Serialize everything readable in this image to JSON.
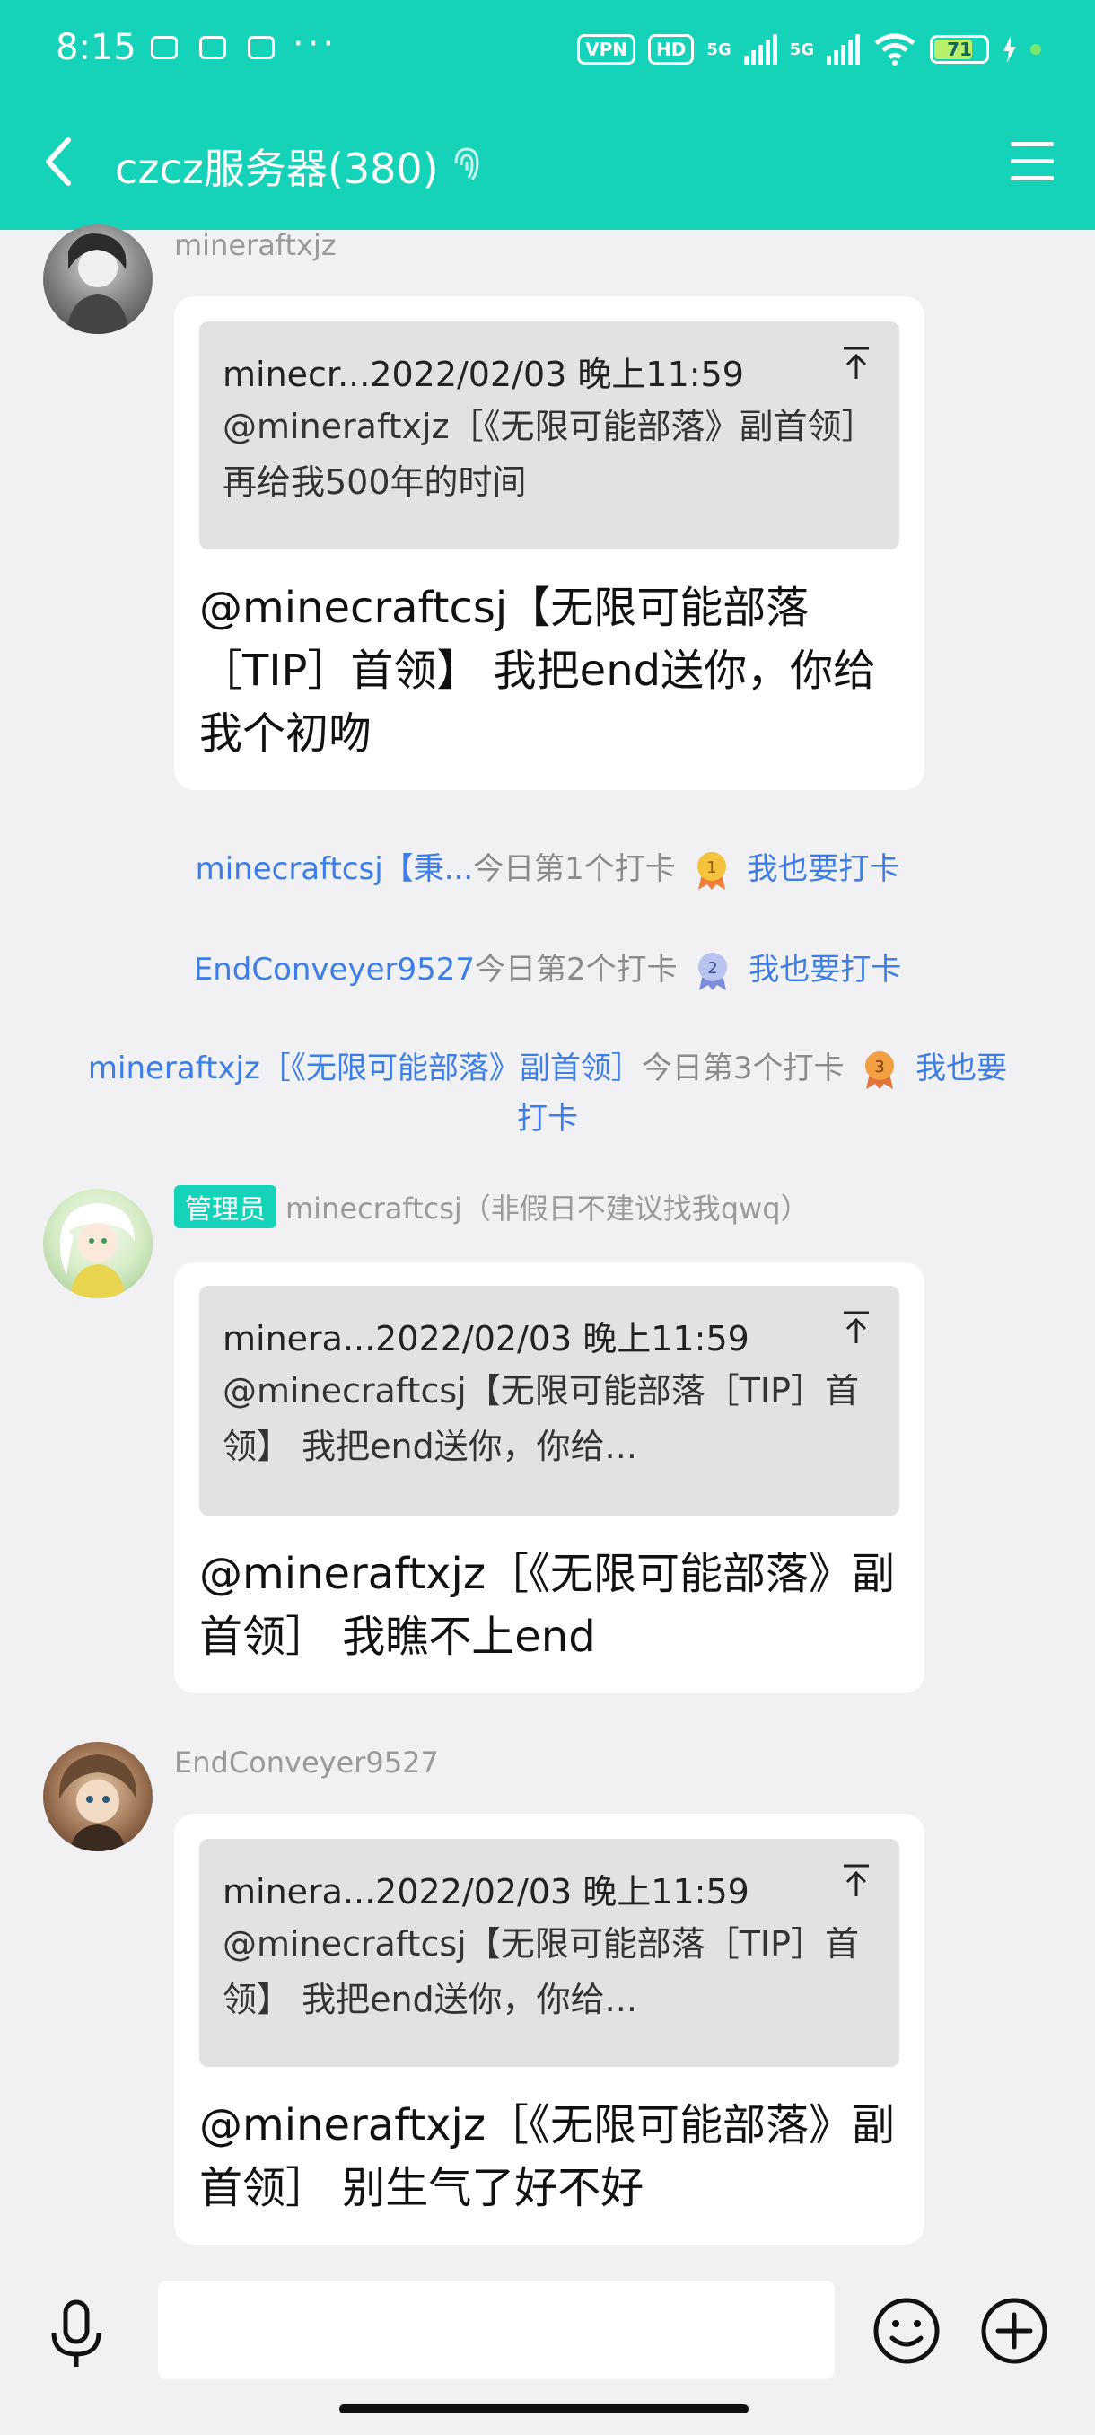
{
  "status_bar": {
    "time": "8:15",
    "more": "···",
    "vpn": "VPN",
    "hd": "HD",
    "net1": "5G",
    "net2": "5G",
    "battery": "71"
  },
  "nav": {
    "title": "czcz服务器(380)"
  },
  "messages": [
    {
      "sender": "mineraftxjz",
      "quote_header": "minecr...2022/02/03 晚上11:59",
      "quote_text": "@mineraftxjz［《无限可能部落》副首领］ 再给我500年的时间",
      "text": "@minecraftcsj【无限可能部落［TIP］首领】 我把end送你，你给我个初吻"
    },
    {
      "badge": "管理员",
      "sender": "minecraftcsj（非假日不建议找我qwq）",
      "quote_header": "minera...2022/02/03 晚上11:59",
      "quote_text": "@minecraftcsj【无限可能部落［TIP］首领】 我把end送你，你给...",
      "text": "@mineraftxjz［《无限可能部落》副首领］ 我瞧不上end"
    },
    {
      "sender": "EndConveyer9527",
      "quote_header": "minera...2022/02/03 晚上11:59",
      "quote_text": "@minecraftcsj【无限可能部落［TIP］首领】 我把end送你，你给...",
      "text": "@mineraftxjz［《无限可能部落》副首领］ 别生气了好不好"
    }
  ],
  "checkins": [
    {
      "user": "minecraftcsj【秉...",
      "text": "今日第1个打卡",
      "medal": "1",
      "action": "我也要打卡"
    },
    {
      "user": "EndConveyer9527",
      "text": "今日第2个打卡",
      "medal": "2",
      "action": "我也要打卡"
    },
    {
      "user": "mineraftxjz［《无限可能部落》副首领］",
      "text": "今日第3个打卡",
      "medal": "3",
      "action_line1": "我也要",
      "action_line2": "打卡"
    }
  ],
  "colors": {
    "brand": "#15d3b8",
    "link": "#3c7de6",
    "background": "#f1f1f3"
  },
  "input": {
    "placeholder": ""
  }
}
